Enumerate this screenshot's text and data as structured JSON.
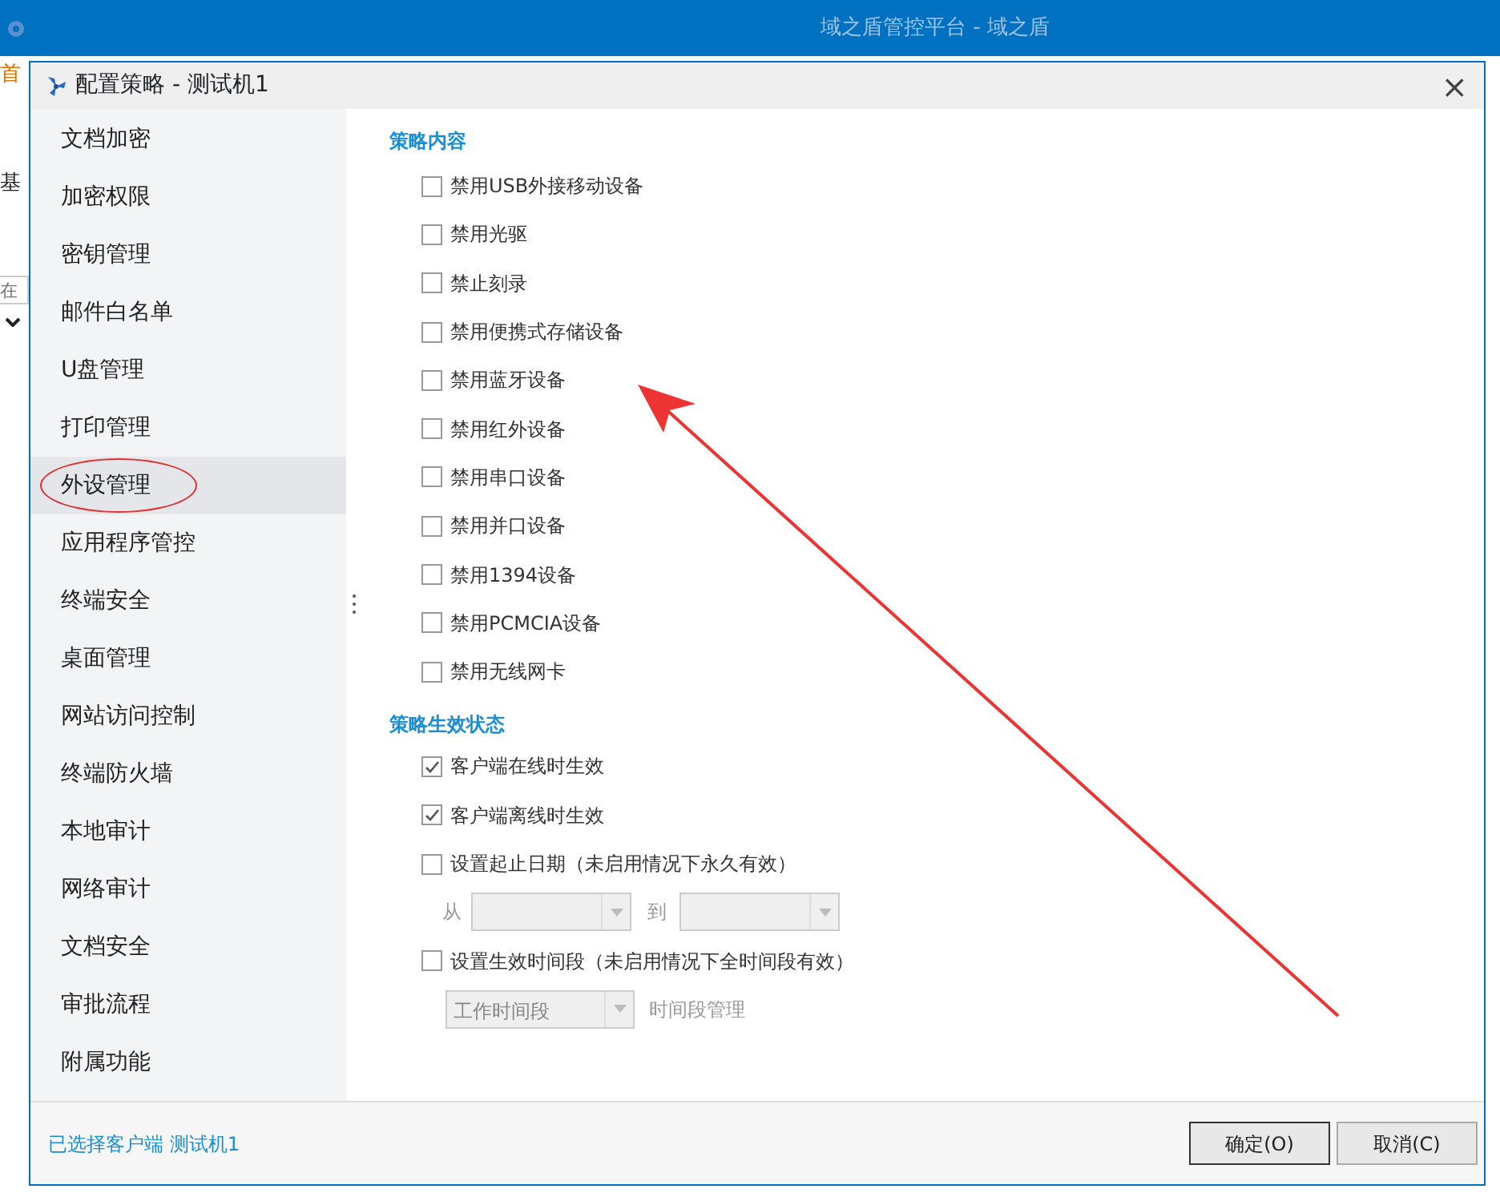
{
  "app_window": {
    "title": "域之盾管控平台 - 域之盾",
    "fragments": [
      {
        "kind": "tab",
        "text": "首"
      },
      {
        "kind": "label",
        "text": "基"
      },
      {
        "kind": "field",
        "placeholder": "在"
      }
    ]
  },
  "dialog": {
    "title": "配置策略 - 测试机1",
    "close": "×"
  },
  "sidebar": {
    "items": [
      {
        "label": "文档加密",
        "selected": false,
        "circled": false
      },
      {
        "label": "加密权限",
        "selected": false,
        "circled": false
      },
      {
        "label": "密钥管理",
        "selected": false,
        "circled": false
      },
      {
        "label": "邮件白名单",
        "selected": false,
        "circled": false
      },
      {
        "label": "U盘管理",
        "selected": false,
        "circled": false
      },
      {
        "label": "打印管理",
        "selected": false,
        "circled": false
      },
      {
        "label": "外设管理",
        "selected": true,
        "circled": true
      },
      {
        "label": "应用程序管控",
        "selected": false,
        "circled": false
      },
      {
        "label": "终端安全",
        "selected": false,
        "circled": false
      },
      {
        "label": "桌面管理",
        "selected": false,
        "circled": false
      },
      {
        "label": "网站访问控制",
        "selected": false,
        "circled": false
      },
      {
        "label": "终端防火墙",
        "selected": false,
        "circled": false
      },
      {
        "label": "本地审计",
        "selected": false,
        "circled": false
      },
      {
        "label": "网络审计",
        "selected": false,
        "circled": false
      },
      {
        "label": "文档安全",
        "selected": false,
        "circled": false
      },
      {
        "label": "审批流程",
        "selected": false,
        "circled": false
      },
      {
        "label": "附属功能",
        "selected": false,
        "circled": false
      }
    ]
  },
  "policy_content": {
    "heading": "策略内容",
    "options": [
      {
        "label": "禁用USB外接移动设备",
        "checked": false
      },
      {
        "label": "禁用光驱",
        "checked": false
      },
      {
        "label": "禁止刻录",
        "checked": false
      },
      {
        "label": "禁用便携式存储设备",
        "checked": false
      },
      {
        "label": "禁用蓝牙设备",
        "checked": false
      },
      {
        "label": "禁用红外设备",
        "checked": false
      },
      {
        "label": "禁用串口设备",
        "checked": false
      },
      {
        "label": "禁用并口设备",
        "checked": false
      },
      {
        "label": "禁用1394设备",
        "checked": false
      },
      {
        "label": "禁用PCMCIA设备",
        "checked": false
      },
      {
        "label": "禁用无线网卡",
        "checked": false
      }
    ]
  },
  "policy_state": {
    "heading": "策略生效状态",
    "items": [
      {
        "kind": "checkbox",
        "label": "客户端在线时生效",
        "checked": true
      },
      {
        "kind": "checkbox",
        "label": "客户端离线时生效",
        "checked": true
      },
      {
        "kind": "checkbox",
        "label": "设置起止日期（未启用情况下永久有效）",
        "checked": false
      },
      {
        "kind": "daterange",
        "from_label": "从",
        "to_label": "到",
        "disabled": true
      },
      {
        "kind": "checkbox",
        "label": "设置生效时间段（未启用情况下全时间段有效）",
        "checked": false
      },
      {
        "kind": "timeslot",
        "value": "工作时间段",
        "link": "时间段管理",
        "disabled": true
      }
    ]
  },
  "footer": {
    "status": "已选择客户端 测试机1",
    "buttons": [
      {
        "label": "确定(O)",
        "selected": true
      },
      {
        "label": "取消(C)",
        "selected": false
      }
    ]
  },
  "annotations": [
    {
      "kind": "arrow"
    }
  ]
}
